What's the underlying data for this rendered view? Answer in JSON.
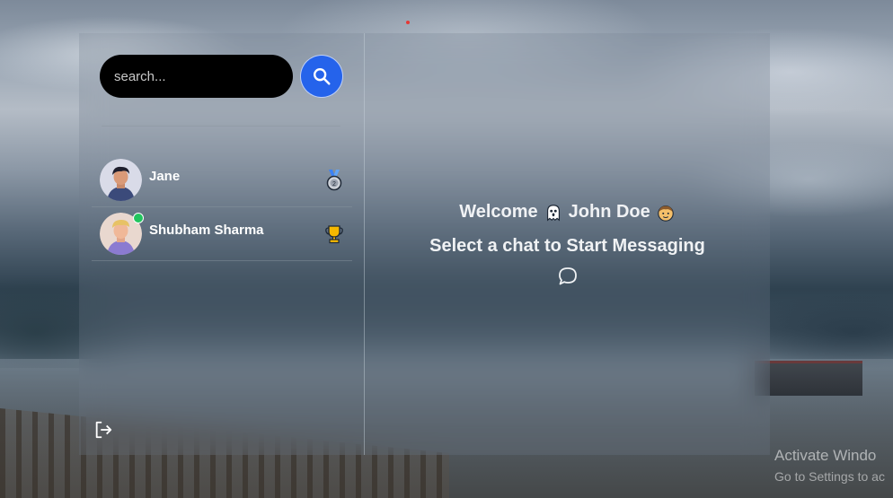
{
  "search": {
    "placeholder": "search...",
    "button_icon": "search-icon",
    "button_color": "#2563eb"
  },
  "conversations": [
    {
      "name": "Jane",
      "badge": "silver-medal-icon",
      "online": false
    },
    {
      "name": "Shubham Sharma",
      "badge": "trophy-icon",
      "online": true
    }
  ],
  "main": {
    "welcome_prefix": "Welcome",
    "user_name": "John Doe",
    "subtitle": "Select a chat to Start Messaging",
    "icon": "chat-bubble-icon"
  },
  "sidebar_footer": {
    "logout_icon": "logout-icon"
  },
  "watermark": {
    "title": "Activate Windo",
    "subtitle": "Go to Settings to ac"
  }
}
